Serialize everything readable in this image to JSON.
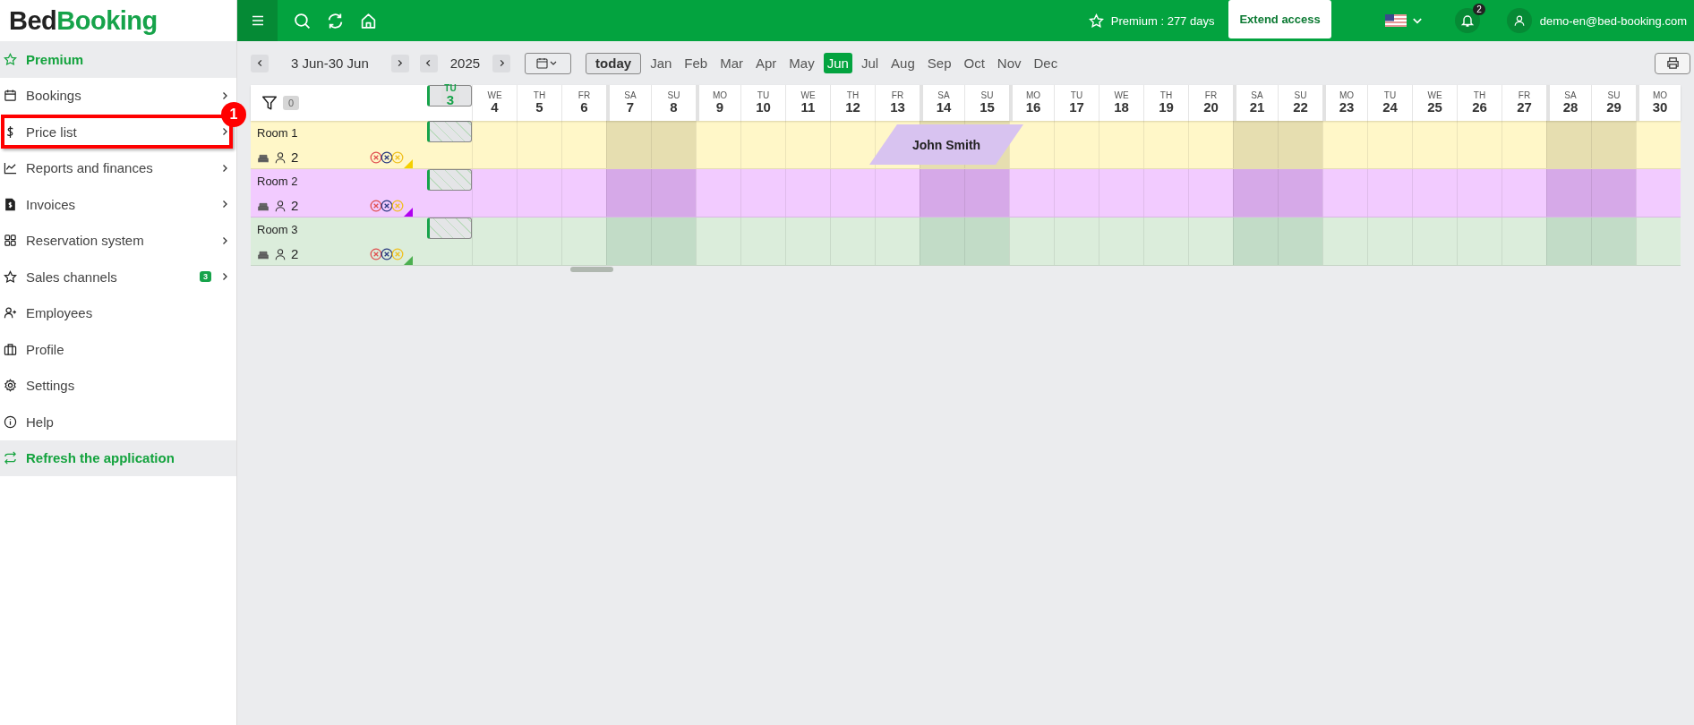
{
  "logo": {
    "part_1": "Bed",
    "part_2": "Booking"
  },
  "sidebar": {
    "items": [
      {
        "label": "Premium",
        "kind": "action",
        "chevron": false
      },
      {
        "label": "Bookings",
        "kind": "link",
        "chevron": true
      },
      {
        "label": "Price list",
        "kind": "link",
        "chevron": true,
        "callout": "1"
      },
      {
        "label": "Reports and finances",
        "kind": "link",
        "chevron": true
      },
      {
        "label": "Invoices",
        "kind": "link",
        "chevron": true
      },
      {
        "label": "Reservation system",
        "kind": "link",
        "chevron": true
      },
      {
        "label": "Sales channels",
        "kind": "link",
        "chevron": true,
        "badge": "3"
      },
      {
        "label": "Employees",
        "kind": "link",
        "chevron": false
      },
      {
        "label": "Profile",
        "kind": "link",
        "chevron": false
      },
      {
        "label": "Settings",
        "kind": "link",
        "chevron": false
      },
      {
        "label": "Help",
        "kind": "link",
        "chevron": false
      },
      {
        "label": "Refresh the application",
        "kind": "action",
        "chevron": false
      }
    ]
  },
  "topbar": {
    "premium": "Premium : 277 days",
    "extend_button": "Extend access",
    "notifications": "2",
    "user_email": "demo-en@bed-booking.com"
  },
  "toolbar": {
    "range": "3 Jun-30 Jun",
    "year": "2025",
    "today_button": "today",
    "months": [
      {
        "label": "Jan",
        "selected": false
      },
      {
        "label": "Feb",
        "selected": false
      },
      {
        "label": "Mar",
        "selected": false
      },
      {
        "label": "Apr",
        "selected": false
      },
      {
        "label": "May",
        "selected": false
      },
      {
        "label": "Jun",
        "selected": true
      },
      {
        "label": "Jul",
        "selected": false
      },
      {
        "label": "Aug",
        "selected": false
      },
      {
        "label": "Sep",
        "selected": false
      },
      {
        "label": "Oct",
        "selected": false
      },
      {
        "label": "Nov",
        "selected": false
      },
      {
        "label": "Dec",
        "selected": false
      }
    ]
  },
  "filter_count": "0",
  "days": [
    {
      "dow": "TU",
      "num": "3",
      "weekend": false,
      "selected": true
    },
    {
      "dow": "WE",
      "num": "4",
      "weekend": false,
      "selected": false
    },
    {
      "dow": "TH",
      "num": "5",
      "weekend": false,
      "selected": false
    },
    {
      "dow": "FR",
      "num": "6",
      "weekend": false,
      "selected": false
    },
    {
      "dow": "SA",
      "num": "7",
      "weekend": true,
      "selected": false
    },
    {
      "dow": "SU",
      "num": "8",
      "weekend": true,
      "selected": false
    },
    {
      "dow": "MO",
      "num": "9",
      "weekend": false,
      "selected": false
    },
    {
      "dow": "TU",
      "num": "10",
      "weekend": false,
      "selected": false
    },
    {
      "dow": "WE",
      "num": "11",
      "weekend": false,
      "selected": false
    },
    {
      "dow": "TH",
      "num": "12",
      "weekend": false,
      "selected": false
    },
    {
      "dow": "FR",
      "num": "13",
      "weekend": false,
      "selected": false
    },
    {
      "dow": "SA",
      "num": "14",
      "weekend": true,
      "selected": false
    },
    {
      "dow": "SU",
      "num": "15",
      "weekend": true,
      "selected": false
    },
    {
      "dow": "MO",
      "num": "16",
      "weekend": false,
      "selected": false
    },
    {
      "dow": "TU",
      "num": "17",
      "weekend": false,
      "selected": false
    },
    {
      "dow": "WE",
      "num": "18",
      "weekend": false,
      "selected": false
    },
    {
      "dow": "TH",
      "num": "19",
      "weekend": false,
      "selected": false
    },
    {
      "dow": "FR",
      "num": "20",
      "weekend": false,
      "selected": false
    },
    {
      "dow": "SA",
      "num": "21",
      "weekend": true,
      "selected": false
    },
    {
      "dow": "SU",
      "num": "22",
      "weekend": true,
      "selected": false
    },
    {
      "dow": "MO",
      "num": "23",
      "weekend": false,
      "selected": false
    },
    {
      "dow": "TU",
      "num": "24",
      "weekend": false,
      "selected": false
    },
    {
      "dow": "WE",
      "num": "25",
      "weekend": false,
      "selected": false
    },
    {
      "dow": "TH",
      "num": "26",
      "weekend": false,
      "selected": false
    },
    {
      "dow": "FR",
      "num": "27",
      "weekend": false,
      "selected": false
    },
    {
      "dow": "SA",
      "num": "28",
      "weekend": true,
      "selected": false
    },
    {
      "dow": "SU",
      "num": "29",
      "weekend": true,
      "selected": false
    },
    {
      "dow": "MO",
      "num": "30",
      "weekend": false,
      "selected": false
    }
  ],
  "rooms": [
    {
      "name": "Room 1",
      "guests": "2",
      "color": "#f5d000",
      "bookings": [
        {
          "guest": "John Smith"
        }
      ]
    },
    {
      "name": "Room 2",
      "guests": "2",
      "color": "#b000f0"
    },
    {
      "name": "Room 3",
      "guests": "2",
      "color": "#4caf50"
    }
  ]
}
